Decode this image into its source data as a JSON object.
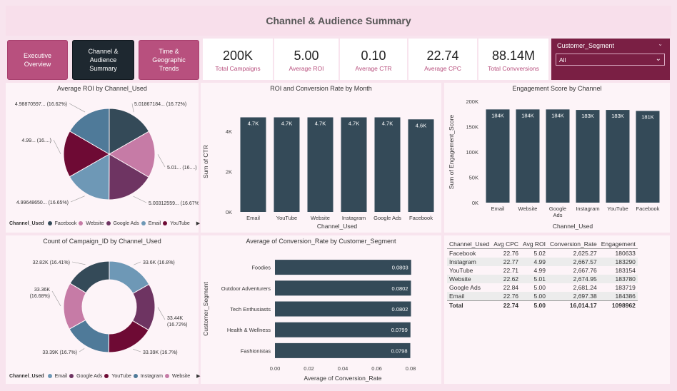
{
  "header": {
    "title": "Channel & Audience Summary"
  },
  "nav": {
    "executive": "Executive Overview",
    "channel": "Channel & Audience Summary",
    "time": "Time & Geographic Trends"
  },
  "kpis": [
    {
      "value": "200K",
      "label": "Total Campaigns"
    },
    {
      "value": "5.00",
      "label": "Average ROI"
    },
    {
      "value": "0.10",
      "label": "Average CTR"
    },
    {
      "value": "22.74",
      "label": "Average CPC"
    },
    {
      "value": "88.14M",
      "label": "Total Convversions"
    }
  ],
  "segment_filter": {
    "label": "Customer_Segment",
    "value": "All"
  },
  "colors": {
    "dark": "#344a58",
    "pink": "#c67ba6",
    "plum": "#6e3462",
    "light_blue": "#6e98b6",
    "maroon": "#6e0a34",
    "blue_grey": "#4f7a99"
  },
  "chart_data": [
    {
      "type": "pie",
      "title": "Average ROI by Channel_Used",
      "legend_title": "Channel_Used",
      "categories": [
        "Facebook",
        "Website",
        "Google Ads",
        "Email",
        "YouTube",
        "Instagram"
      ],
      "values": [
        5.01867184,
        5.01,
        5.00312559,
        4.9964865,
        4.99,
        4.98870597
      ],
      "percents": [
        16.72,
        16.68,
        16.67,
        16.65,
        16.63,
        16.62
      ],
      "labels": [
        "5.01867184... (16.72%)",
        "5.01... (16....)",
        "5.00312559... (16.67%)",
        "4.99648650... (16.65%)",
        "4.99... (16....)",
        "4.98870597... (16.62%)"
      ],
      "legend": [
        "Facebook",
        "Website",
        "Google Ads",
        "Email",
        "YouTube"
      ]
    },
    {
      "type": "bar",
      "title": "ROI and Conversion Rate by Month",
      "xlabel": "Channel_Used",
      "ylabel": "Sum of CTR",
      "categories": [
        "Email",
        "YouTube",
        "Website",
        "Instagram",
        "Google Ads",
        "Facebook"
      ],
      "values": [
        4700,
        4700,
        4700,
        4700,
        4700,
        4600
      ],
      "data_labels": [
        "4.7K",
        "4.7K",
        "4.7K",
        "4.7K",
        "4.7K",
        "4.6K"
      ],
      "yticks": [
        "0K",
        "2K",
        "4K"
      ],
      "ylim": [
        0,
        5000
      ]
    },
    {
      "type": "bar",
      "title": "Engagement Score by Channel",
      "xlabel": "Channel_Used",
      "ylabel": "Sum of Engagement_Score",
      "categories": [
        "Email",
        "Website",
        "Google Ads",
        "Instagram",
        "YouTube",
        "Facebook"
      ],
      "values": [
        184000,
        184000,
        184000,
        183000,
        183000,
        181000
      ],
      "data_labels": [
        "184K",
        "184K",
        "184K",
        "183K",
        "183K",
        "181K"
      ],
      "yticks": [
        "0K",
        "50K",
        "100K",
        "150K",
        "200K"
      ],
      "ylim": [
        0,
        200000
      ]
    },
    {
      "type": "pie",
      "title": "Count of Campaign_ID by Channel_Used",
      "legend_title": "Channel_Used",
      "categories": [
        "Email",
        "Google Ads",
        "YouTube",
        "Instagram",
        "Website",
        "Facebook"
      ],
      "values": [
        33600,
        33440,
        33390,
        33390,
        33360,
        32820
      ],
      "percents": [
        16.8,
        16.72,
        16.7,
        16.7,
        16.68,
        16.41
      ],
      "labels": [
        "33.6K (16.8%)",
        "33.44K (16.72%)",
        "33.39K (16.7%)",
        "33.39K (16.7%)",
        "33.36K (16.68%)",
        "32.82K (16.41%)"
      ],
      "legend": [
        "Email",
        "Google Ads",
        "YouTube",
        "Instagram",
        "Website"
      ]
    },
    {
      "type": "bar",
      "orientation": "horizontal",
      "title": "Average of Conversion_Rate by Customer_Segment",
      "xlabel": "Average of Conversion_Rate",
      "ylabel": "Customer_Segment",
      "categories": [
        "Foodies",
        "Outdoor Adventurers",
        "Tech Enthusiasts",
        "Health & Wellness",
        "Fashionistas"
      ],
      "values": [
        0.0803,
        0.0802,
        0.0802,
        0.0799,
        0.0798
      ],
      "data_labels": [
        "0.0803",
        "0.0802",
        "0.0802",
        "0.0799",
        "0.0798"
      ],
      "xticks": [
        "0.00",
        "0.02",
        "0.04",
        "0.06",
        "0.08"
      ],
      "xlim": [
        0,
        0.08
      ]
    },
    {
      "type": "table",
      "columns": [
        "Channel_Used",
        "Avg CPC",
        "Avg ROI",
        "Conversion_Rate",
        "Engagement"
      ],
      "rows": [
        [
          "Facebook",
          "22.76",
          "5.02",
          "2,625.27",
          "180633"
        ],
        [
          "Instagram",
          "22.77",
          "4.99",
          "2,667.57",
          "183290"
        ],
        [
          "YouTube",
          "22.71",
          "4.99",
          "2,667.76",
          "183154"
        ],
        [
          "Website",
          "22.62",
          "5.01",
          "2,674.95",
          "183780"
        ],
        [
          "Google Ads",
          "22.84",
          "5.00",
          "2,681.24",
          "183719"
        ],
        [
          "Email",
          "22.76",
          "5.00",
          "2,697.38",
          "184386"
        ]
      ],
      "total": [
        "Total",
        "22.74",
        "5.00",
        "16,014.17",
        "1098962"
      ]
    }
  ]
}
